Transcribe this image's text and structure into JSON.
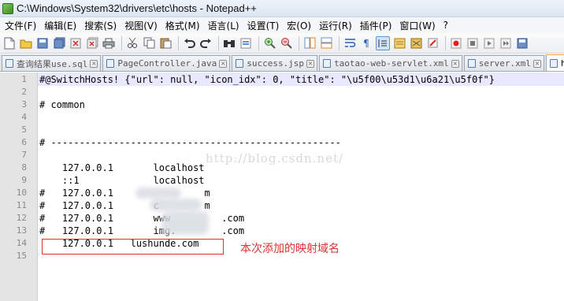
{
  "window": {
    "title": "C:\\Windows\\System32\\drivers\\etc\\hosts - Notepad++"
  },
  "menu": [
    "文件(F)",
    "编辑(E)",
    "搜索(S)",
    "视图(V)",
    "格式(M)",
    "语言(L)",
    "设置(T)",
    "宏(O)",
    "运行(R)",
    "插件(P)",
    "窗口(W)",
    "?"
  ],
  "toolbar": {
    "icons": [
      "new-file-icon",
      "open-file-icon",
      "save-icon",
      "save-all-icon",
      "close-icon",
      "close-all-icon",
      "print-icon",
      "cut-icon",
      "copy-icon",
      "paste-icon",
      "undo-icon",
      "redo-icon",
      "find-icon",
      "replace-icon",
      "zoom-in-icon",
      "zoom-out-icon",
      "sync-v-icon",
      "sync-h-icon",
      "word-wrap-icon",
      "show-all-chars-icon",
      "indent-guide-icon",
      "doc-map-icon",
      "function-list-icon",
      "folder-workspace-icon",
      "record-macro-icon",
      "stop-record-icon",
      "play-macro-icon",
      "run-macro-icon",
      "save-macro-icon"
    ]
  },
  "tabs": [
    {
      "label": "查询结果use.sql",
      "active": false
    },
    {
      "label": "PageController.java",
      "active": false
    },
    {
      "label": "success.jsp",
      "active": false
    },
    {
      "label": "taotao-web-servlet.xml",
      "active": false
    },
    {
      "label": "server.xml",
      "active": false
    },
    {
      "label": "hosts",
      "active": true
    }
  ],
  "editor": {
    "line_numbers": [
      "1",
      "2",
      "3",
      "4",
      "5",
      "6",
      "7",
      "8",
      "9",
      "10",
      "11",
      "12",
      "13",
      "14",
      "15"
    ],
    "lines": [
      "#@SwitchHosts! {\"url\": null, \"icon_idx\": 0, \"title\": \"\\u5f00\\u53d1\\u6a21\\u5f0f\"}",
      "",
      "# common",
      "",
      "",
      "# ---------------------------------------------------",
      "",
      "    127.0.0.1       localhost",
      "    ::1             localhost",
      "#   127.0.0.1                m",
      "#   127.0.0.1       c        m",
      "#   127.0.0.1       www         .com",
      "#   127.0.0.1       img.        .com",
      "    127.0.0.1   lushunde.com",
      ""
    ],
    "watermark": "http://blog.csdn.net/",
    "annotation": "本次添加的映射域名"
  },
  "colors": {
    "annotation": "#e03030",
    "gutter": "#e4e4e4",
    "current_line": "#e8e8ff"
  }
}
